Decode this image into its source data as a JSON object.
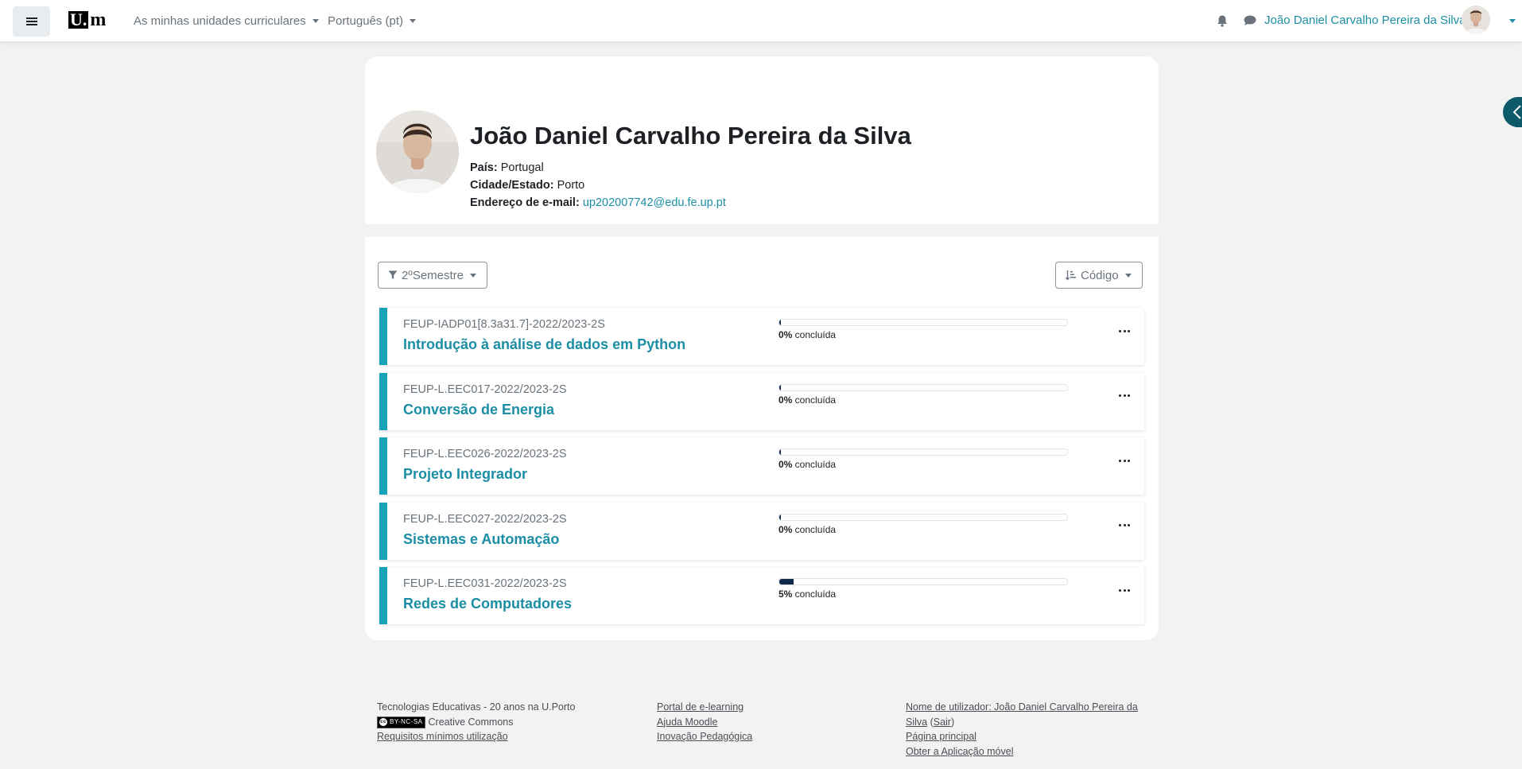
{
  "navbar": {
    "menu_icon": "hamburger-icon",
    "logo": {
      "u": "U.",
      "m": "m"
    },
    "my_courses_label": "As minhas unidades curriculares",
    "language_label": "Português (pt)",
    "notifications_icon": "bell-icon",
    "messages_icon": "chat-icon",
    "user_name": "João Daniel Carvalho Pereira da Silva"
  },
  "drawer": {
    "toggle_icon": "chevron-left-icon"
  },
  "profile": {
    "name": "João Daniel Carvalho Pereira da Silva",
    "country_label": "País:",
    "country_value": "Portugal",
    "city_label": "Cidade/Estado:",
    "city_value": "Porto",
    "email_label": "Endereço de e-mail:",
    "email_value": "up202007742@edu.fe.up.pt"
  },
  "courses": {
    "filter_label": "2ºSemestre",
    "filter_icon": "filter-icon",
    "sort_label": "Código",
    "sort_icon": "sort-icon",
    "progress_suffix": " concluída",
    "items": [
      {
        "code": "FEUP-IADP01[8.3a31.7]-2022/2023-2S",
        "name": "Introdução à análise de dados em Python",
        "progress": 0,
        "progress_label": "0%"
      },
      {
        "code": "FEUP-L.EEC017-2022/2023-2S",
        "name": "Conversão de Energia",
        "progress": 0,
        "progress_label": "0%"
      },
      {
        "code": "FEUP-L.EEC026-2022/2023-2S",
        "name": "Projeto Integrador",
        "progress": 0,
        "progress_label": "0%"
      },
      {
        "code": "FEUP-L.EEC027-2022/2023-2S",
        "name": "Sistemas e Automação",
        "progress": 0,
        "progress_label": "0%"
      },
      {
        "code": "FEUP-L.EEC031-2022/2023-2S",
        "name": "Redes de Computadores",
        "progress": 5,
        "progress_label": "5%"
      }
    ]
  },
  "footer": {
    "col1": {
      "line1": "Tecnologias Educativas - 20 anos na U.Porto",
      "cc_badge": "BY-NC-SA",
      "cc_text": "Creative Commons",
      "requirements_link": "Requisitos mínimos utilização"
    },
    "col2": {
      "portal_link": "Portal de e-learning",
      "help_link": "Ajuda Moodle",
      "innovation_link": "Inovação Pedagógica"
    },
    "col3": {
      "username_link_a": "Nome de utilizador: João Daniel Carvalho Pereira da",
      "username_link_b": "Silva",
      "logout_open": " (",
      "logout_link": "Sair",
      "logout_close": ")",
      "home_link": "Página principal",
      "app_link": "Obter a Aplicação móvel"
    }
  },
  "colors": {
    "accent": "#17a2b8",
    "link": "#1b8ea5",
    "progress_fill": "#0f2a4a",
    "background": "#f2f2f2"
  }
}
